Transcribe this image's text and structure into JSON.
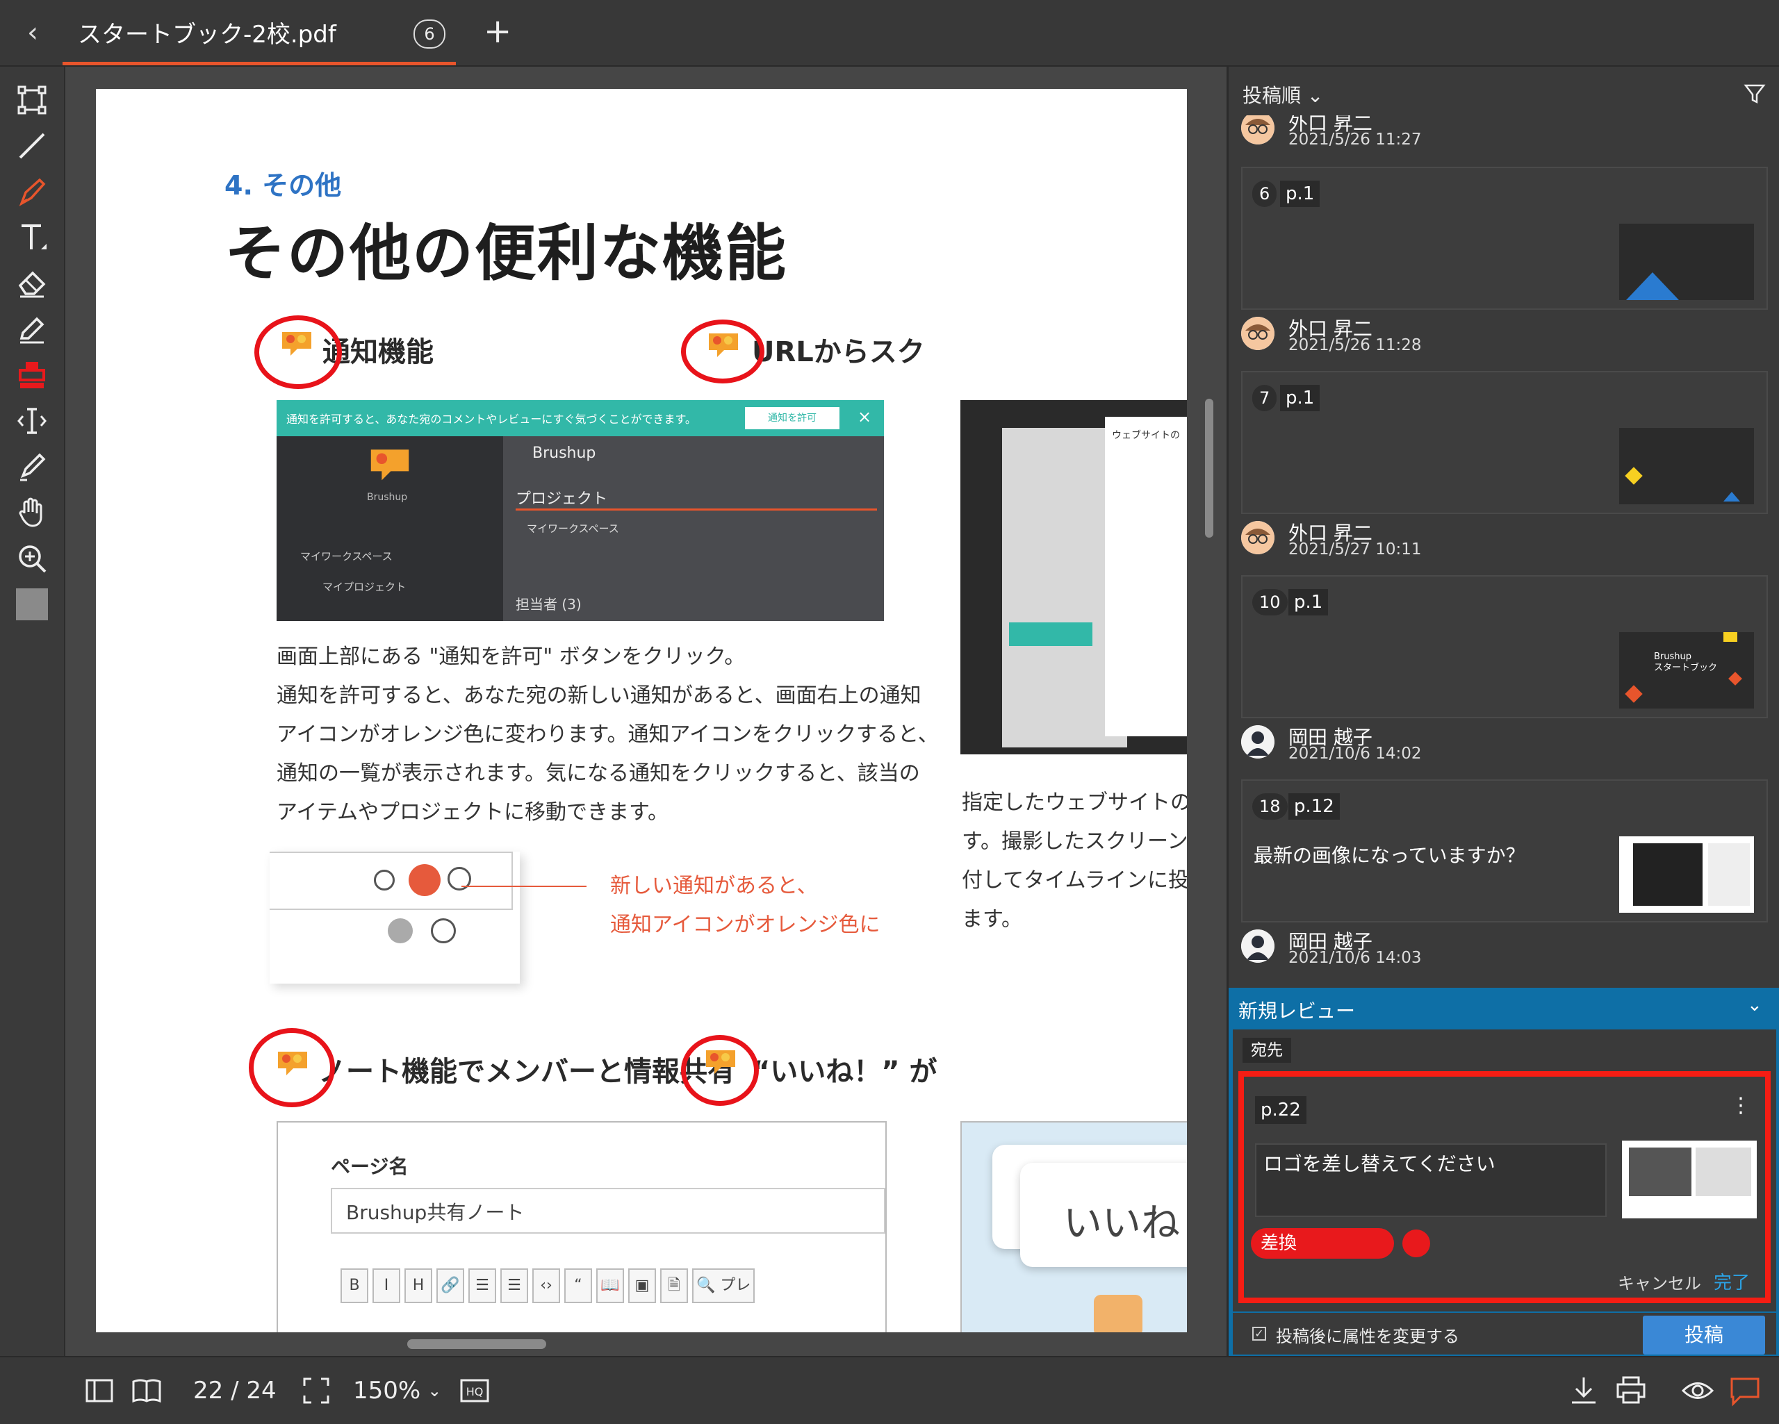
{
  "tab": {
    "title": "スタートブック-2校.pdf",
    "count": "6",
    "add": "+"
  },
  "document": {
    "section_no": "4. その他",
    "heading": "その他の便利な機能",
    "features": {
      "notify_title": "通知機能",
      "url_title": "URLからスク",
      "note_title": "ノート機能でメンバーと情報共有",
      "like_title": "“いいね！” が"
    },
    "notify_banner": "通知を許可すると、あなた宛のコメントやレビューにすぐ気づくことができます。",
    "notify_button": "通知を許可",
    "brushup": "Brushup",
    "project": "プロジェクト",
    "myworkspace": "マイワークスペース",
    "myproject": "マイプロジェクト",
    "assignee": "担当者 (3)",
    "website": "ウェブサイトの",
    "notify_body": [
      "画面上部にある \"通知を許可\" ボタンをクリック。",
      "通知を許可すると、あなた宛の新しい通知があると、画面右上の通知",
      "アイコンがオレンジ色に変わります。通知アイコンをクリックすると、",
      "通知の一覧が表示されます。気になる通知をクリックすると、該当の",
      "アイテムやプロジェクトに移動できます。"
    ],
    "callout": [
      "新しい通知があると、",
      "通知アイコンがオレンジ色に"
    ],
    "url_body": [
      "指定したウェブサイトの",
      "す。撮影したスクリーンシ",
      "付してタイムラインに投稿",
      "ます。"
    ],
    "page_name_label": "ページ名",
    "page_name_value": "Brushup共有ノート",
    "editor_buttons": [
      "B",
      "I",
      "H",
      "🔗",
      "☰",
      "☰",
      "‹›",
      "“",
      "📖",
      "▣",
      "🗎",
      "🔍 プレ"
    ],
    "like_bubble": "いいね"
  },
  "panel": {
    "sort_label": "投稿順",
    "comments": [
      {
        "author": "外口 昇二",
        "date": "2021/5/26 11:27"
      },
      {
        "author": "外口 昇二",
        "date": "2021/5/26 11:28"
      },
      {
        "author": "外口 昇二",
        "date": "2021/5/27 10:11"
      },
      {
        "author": "岡田 越子",
        "date": "2021/10/6 14:02"
      },
      {
        "author": "岡田 越子",
        "date": "2021/10/6 14:03"
      }
    ],
    "cards": [
      {
        "num": "6",
        "page": "p.1",
        "text": ""
      },
      {
        "num": "7",
        "page": "p.1",
        "text": ""
      },
      {
        "num": "10",
        "page": "p.1",
        "text": ""
      },
      {
        "num": "18",
        "page": "p.12",
        "text": "最新の画像になっていますか？"
      }
    ],
    "thumb_caption": "Brushup\nスタートブック"
  },
  "review": {
    "title": "新規レビュー",
    "to_label": "宛先",
    "page": "p.22",
    "menu": "⋮",
    "text": "ロゴを差し替えてください",
    "tag": "差換",
    "cancel": "キャンセル",
    "done": "完了",
    "attr_label": "投稿後に属性を変更する",
    "post": "投稿"
  },
  "bottom": {
    "page_indicator": "22 / 24",
    "zoom": "150%"
  },
  "colors": {
    "accent": "#e8552c",
    "review_blue": "#0e6fa6",
    "annotation_red": "#e8131a",
    "link_blue": "#2ba3e6"
  }
}
